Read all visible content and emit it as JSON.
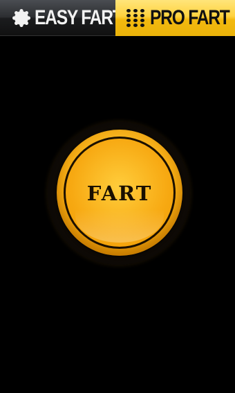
{
  "tabs": {
    "easy": {
      "label": "EASY FART",
      "icon": "gear-icon"
    },
    "pro": {
      "label": "PRO FART",
      "icon": "grid-dots-icon",
      "selected": true
    }
  },
  "main": {
    "button_label": "FART"
  },
  "colors": {
    "background": "#000000",
    "tab_active": "#ffd23f",
    "tab_inactive": "#2c2e31",
    "button_orange": "#f6ad14"
  }
}
